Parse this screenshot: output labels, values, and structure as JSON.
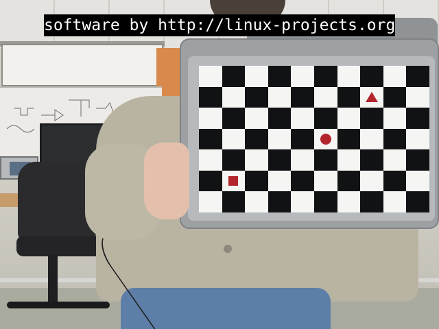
{
  "overlay": {
    "caption": "software by http://linux-projects.org"
  },
  "calibration_board": {
    "rows": 7,
    "columns": 10,
    "dark_color": "#111214",
    "light_color": "#f5f5f3",
    "frame_color": "#9da1a4",
    "markers": [
      {
        "shape": "triangle",
        "color": "#b3262d",
        "row": 1,
        "column": 7
      },
      {
        "shape": "circle",
        "color": "#b3262d",
        "row": 3,
        "column": 5
      },
      {
        "shape": "square",
        "color": "#b3262d",
        "row": 5,
        "column": 1
      }
    ]
  },
  "scene": {
    "wall_color": "#d9894b",
    "shirt_color": "#b9b3a2",
    "jeans_color": "#5d7ea7"
  }
}
